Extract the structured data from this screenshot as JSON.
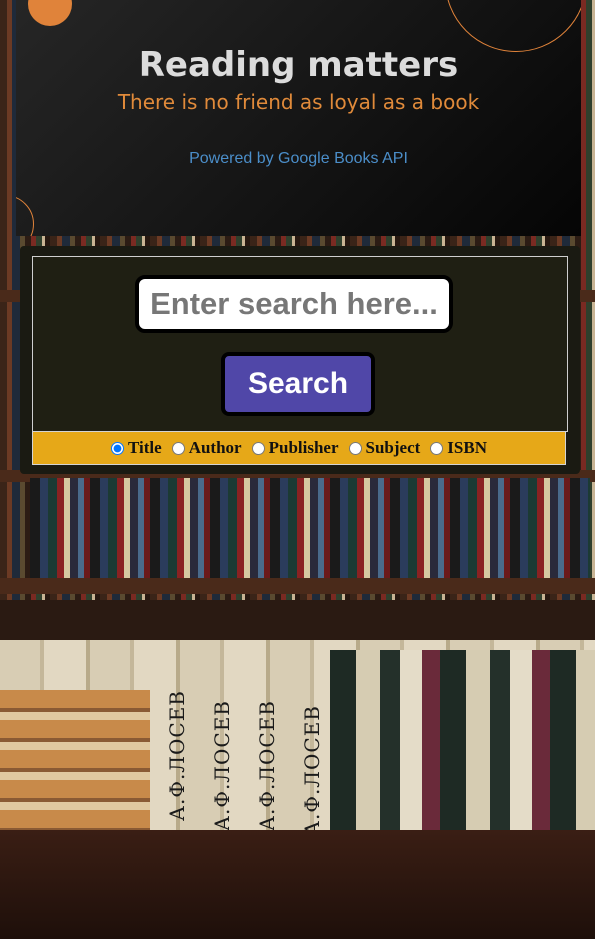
{
  "hero": {
    "title": "Reading matters",
    "tagline": "There is no friend as loyal as a book",
    "powered_by": "Powered by Google Books API"
  },
  "search": {
    "placeholder": "Enter search here...",
    "button_label": "Search"
  },
  "filters": {
    "selected": "Title",
    "options": [
      "Title",
      "Author",
      "Publisher",
      "Subject",
      "ISBN"
    ]
  },
  "background": {
    "spine_label": "А.Ф.ЛОСЕВ"
  },
  "colors": {
    "accent_orange": "#e0833a",
    "link_blue": "#4b8ec9",
    "button_purple": "#5047a8",
    "filter_bar_yellow": "#e6a818"
  }
}
